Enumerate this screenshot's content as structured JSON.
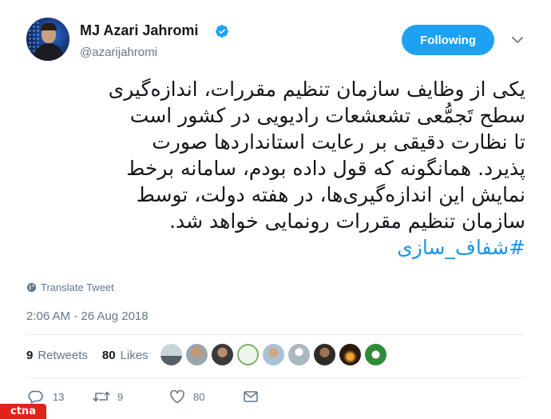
{
  "tweet": {
    "author_name": "MJ Azari Jahromi",
    "author_handle": "@azarijahromi",
    "follow_label": "Following",
    "text_lines": [
      "یکی از وظایف سازمان تنظیم مقررات، اندازه‌گیری",
      "سطح تَجمُّعی تشعشعات رادیویی در کشور است",
      "تا نظارت دقیقی بر رعایت استانداردها صورت",
      "پذیرد. همانگونه که قول داده بودم، سامانه برخط",
      "نمایش این اندازه‌گیری‌ها، در هفته دولت، توسط",
      "سازمان تنظیم مقررات رونمایی خواهد شد."
    ],
    "hashtag": "#شفاف_سازی",
    "translate_label": "Translate Tweet",
    "timestamp": "2:06 AM - 26 Aug 2018",
    "retweets_count": "9",
    "retweets_label": "Retweets",
    "likes_count": "80",
    "likes_label": "Likes",
    "replies": "13",
    "retweet_action_count": "9",
    "like_action_count": "80"
  },
  "watermark": "ctna",
  "colors": {
    "accent": "#1da1f2",
    "link": "#1b95e0",
    "muted": "#657786",
    "watermark": "#e2231a"
  },
  "icons": [
    "verified-badge-icon",
    "chevron-down-icon",
    "globe-icon",
    "reply-icon",
    "retweet-icon",
    "heart-icon",
    "mail-icon"
  ]
}
